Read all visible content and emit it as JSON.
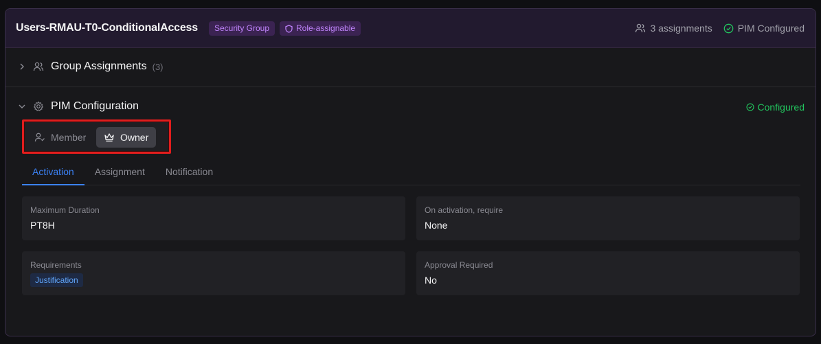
{
  "header": {
    "title": "Users-RMAU-T0-ConditionalAccess",
    "badges": {
      "security_group": "Security Group",
      "role_assignable": "Role-assignable"
    },
    "assignments": "3 assignments",
    "pim_status": "PIM Configured",
    "icons": {
      "assignments": "users-icon",
      "pim": "check-circle-icon",
      "role_assignable": "shield-icon"
    }
  },
  "group_assignments": {
    "label": "Group Assignments",
    "count": "(3)",
    "expanded": false
  },
  "pim": {
    "label": "PIM Configuration",
    "status": "Configured",
    "expanded": true,
    "roles": {
      "member": "Member",
      "owner": "Owner",
      "selected": "Owner"
    },
    "tabs": [
      "Activation",
      "Assignment",
      "Notification"
    ],
    "active_tab": "Activation",
    "fields": {
      "max_duration": {
        "label": "Maximum Duration",
        "value": "PT8H"
      },
      "on_activation": {
        "label": "On activation, require",
        "value": "None"
      },
      "requirements": {
        "label": "Requirements",
        "chip": "Justification"
      },
      "approval": {
        "label": "Approval Required",
        "value": "No"
      }
    }
  },
  "colors": {
    "accent": "#3b82f6",
    "badge_purple": "#c084fc",
    "success": "#22c55e",
    "highlight": "#e11d1d"
  }
}
